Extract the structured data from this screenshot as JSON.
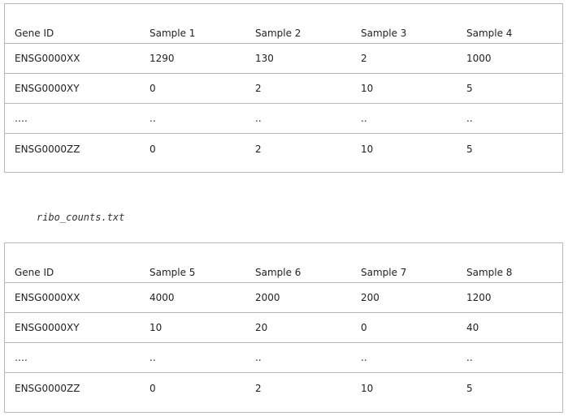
{
  "table1": {
    "headers": [
      "Gene ID",
      "Sample 1",
      "Sample 2",
      "Sample 3",
      "Sample 4"
    ],
    "rows": [
      [
        "ENSG0000XX",
        "1290",
        "130",
        "2",
        "1000"
      ],
      [
        "ENSG0000XY",
        "0",
        "2",
        "10",
        "5"
      ],
      [
        "….",
        "..",
        "..",
        "..",
        ".."
      ],
      [
        "ENSG0000ZZ",
        "0",
        "2",
        "10",
        "5"
      ]
    ]
  },
  "caption": "ribo_counts.txt",
  "table2": {
    "headers": [
      "Gene ID",
      "Sample 5",
      "Sample 6",
      "Sample 7",
      "Sample 8"
    ],
    "rows": [
      [
        "ENSG0000XX",
        "4000",
        "2000",
        "200",
        "1200"
      ],
      [
        "ENSG0000XY",
        "10",
        "20",
        "0",
        "40"
      ],
      [
        "….",
        "..",
        "..",
        "..",
        ".."
      ],
      [
        "ENSG0000ZZ",
        "0",
        "2",
        "10",
        "5"
      ]
    ]
  }
}
